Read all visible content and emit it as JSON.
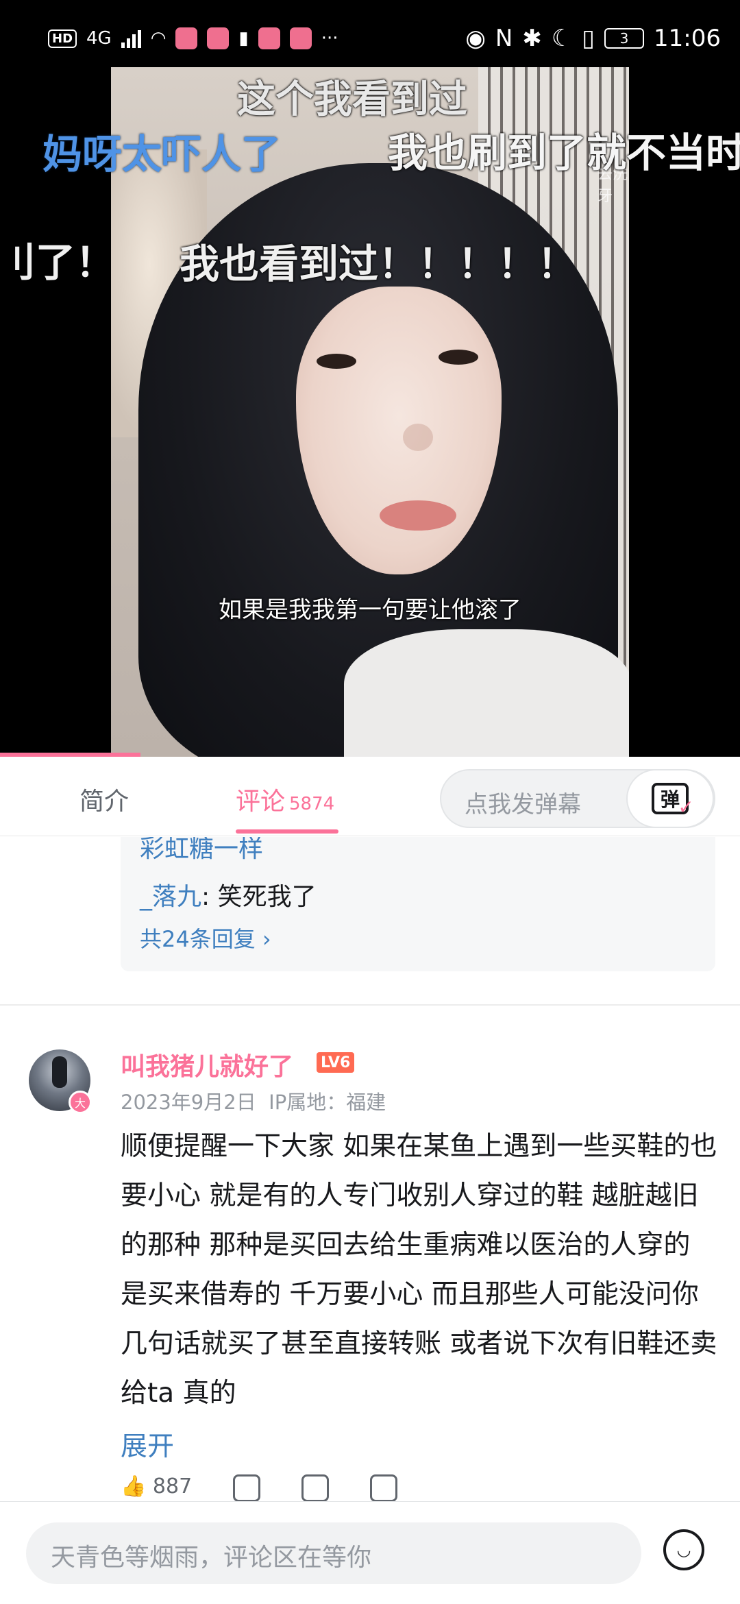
{
  "status_bar": {
    "hd": "HD",
    "network": "4G",
    "more": "···",
    "battery": "3",
    "time": "11:06"
  },
  "video": {
    "watermark": "去洗牙",
    "danmaku": [
      "这个我看到过",
      "妈呀太吓人了",
      "我也刷到了就不当时看",
      "刂了！",
      "我也看到过！！！！！"
    ],
    "subtitle": "如果是我我第一句要让他滚了",
    "progress_fraction": 0.19
  },
  "tabs": {
    "intro": "简介",
    "comments": "评论",
    "comments_count": "5874",
    "danmaku_placeholder": "点我发弹幕",
    "danmaku_button": "弹"
  },
  "replies": {
    "line1": "彩虹糖一样",
    "line2_user": "_落九",
    "line2_text": ": 笑死我了",
    "more": "共24条回复 ›"
  },
  "comment": {
    "username": "叫我猪儿就好了",
    "level": "LV6",
    "badge": "大",
    "date": "2023年9月2日",
    "ip": "IP属地：福建",
    "text": "顺便提醒一下大家 如果在某鱼上遇到一些买鞋的也要小心 就是有的人专门收别人穿过的鞋 越脏越旧的那种 那种是买回去给生重病难以医治的人穿的 是买来借寿的 千万要小心 而且那些人可能没问你几句话就买了甚至直接转账 或者说下次有旧鞋还卖给ta 真的",
    "expand": "展开",
    "likes": "887"
  },
  "bottom": {
    "placeholder": "天青色等烟雨，评论区在等你"
  },
  "colors": {
    "accent": "#fb7299",
    "link": "#3f7fbf"
  }
}
